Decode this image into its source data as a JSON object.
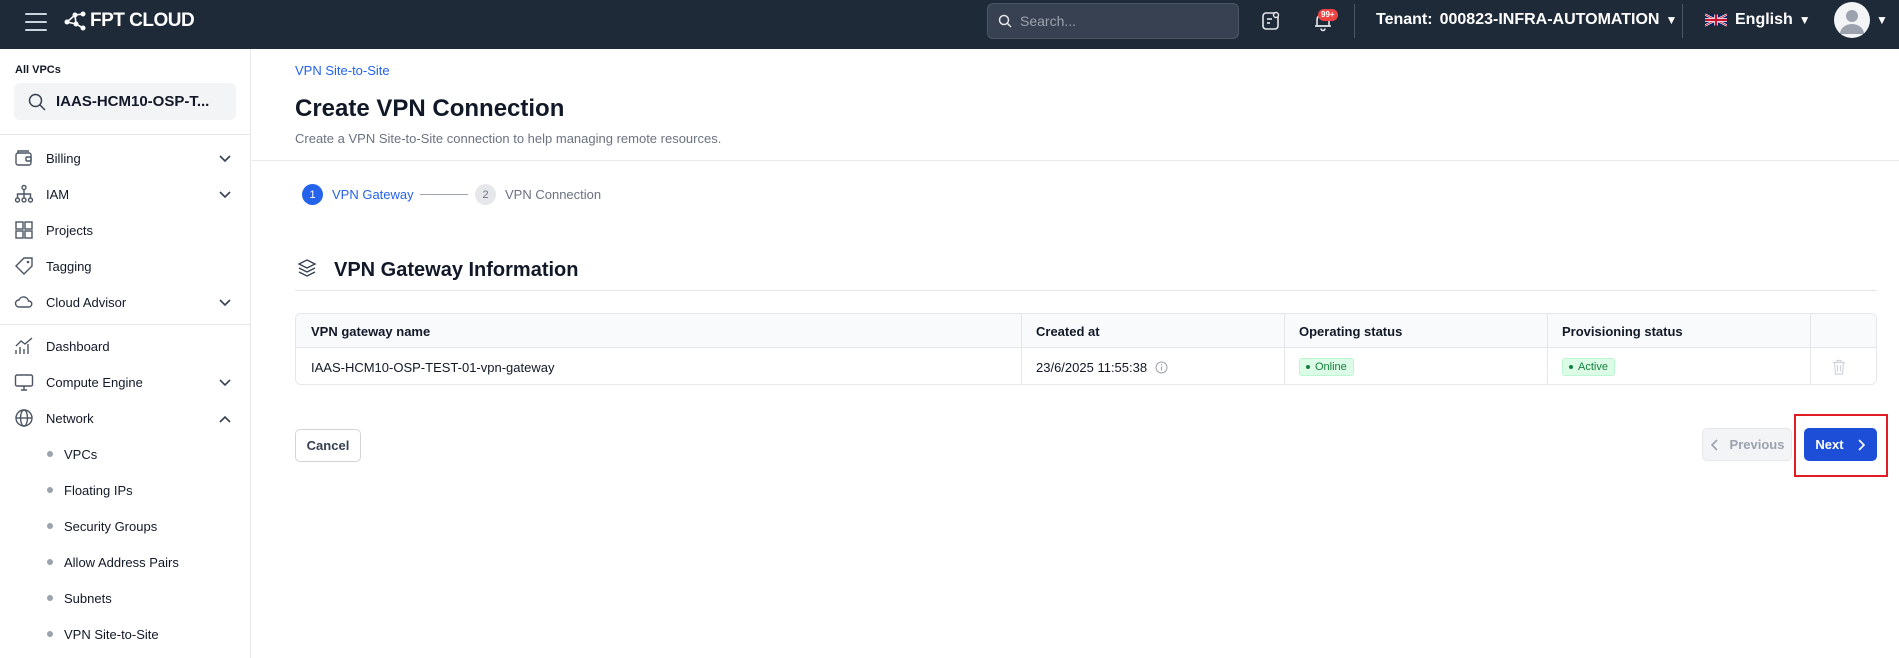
{
  "topbar": {
    "logo_text": "FPT CLOUD",
    "search_placeholder": "Search...",
    "notification_badge": "99+",
    "tenant_label": "Tenant:",
    "tenant_value": "000823-INFRA-AUTOMATION",
    "language": "English",
    "background_color": "#1e2a38"
  },
  "sidebar": {
    "vpc_label": "All VPCs",
    "vpc_selected": "IAAS-HCM10-OSP-T...",
    "items": [
      {
        "label": "Billing",
        "icon": "wallet-icon",
        "expandable": true,
        "expanded": false
      },
      {
        "label": "IAM",
        "icon": "hierarchy-icon",
        "expandable": true,
        "expanded": false
      },
      {
        "label": "Projects",
        "icon": "grid-icon",
        "expandable": false
      },
      {
        "label": "Tagging",
        "icon": "tag-icon",
        "expandable": false
      },
      {
        "label": "Cloud Advisor",
        "icon": "cloud-icon",
        "expandable": true,
        "expanded": false
      },
      {
        "label": "Dashboard",
        "icon": "chart-icon",
        "expandable": false
      },
      {
        "label": "Compute Engine",
        "icon": "monitor-icon",
        "expandable": true,
        "expanded": false
      },
      {
        "label": "Network",
        "icon": "globe-icon",
        "expandable": true,
        "expanded": true
      }
    ],
    "network_subitems": [
      "VPCs",
      "Floating IPs",
      "Security Groups",
      "Allow Address Pairs",
      "Subnets",
      "VPN Site-to-Site"
    ]
  },
  "main": {
    "breadcrumb": "VPN Site-to-Site",
    "title": "Create VPN Connection",
    "subtitle": "Create a VPN Site-to-Site connection to help managing remote resources.",
    "steps": [
      {
        "number": "1",
        "label": "VPN Gateway",
        "active": true
      },
      {
        "number": "2",
        "label": "VPN Connection",
        "active": false
      }
    ],
    "section_title": "VPN Gateway Information",
    "table": {
      "headers": [
        "VPN gateway name",
        "Created at",
        "Operating status",
        "Provisioning status"
      ],
      "rows": [
        {
          "name": "IAAS-HCM10-OSP-TEST-01-vpn-gateway",
          "created_at": "23/6/2025 11:55:38",
          "operating_status": "Online",
          "provisioning_status": "Active"
        }
      ]
    },
    "buttons": {
      "cancel": "Cancel",
      "previous": "Previous",
      "next": "Next"
    },
    "accent_color": "#1d4ed8",
    "status_color": "#15803d"
  }
}
